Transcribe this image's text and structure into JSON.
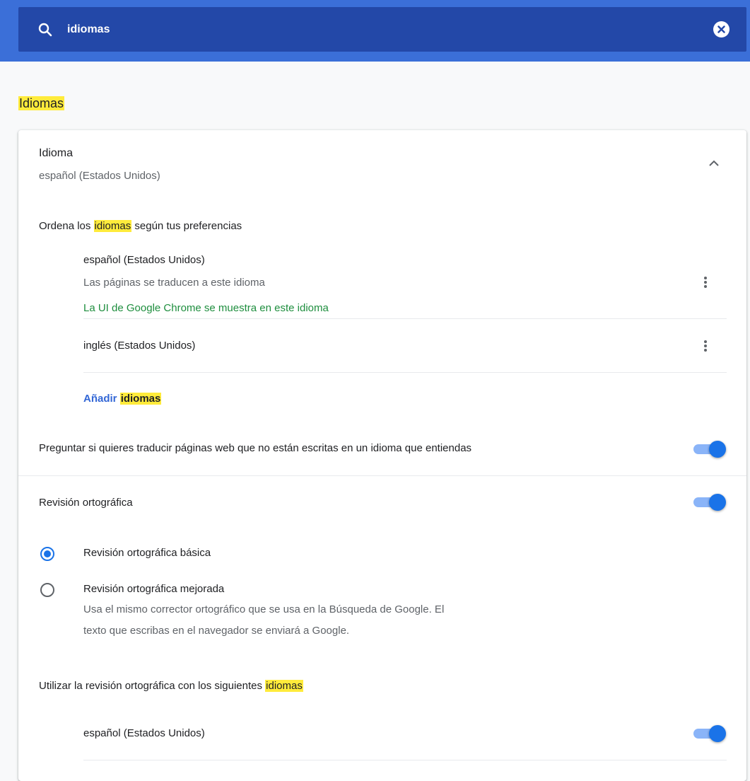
{
  "search": {
    "query": "idiomas"
  },
  "section": {
    "title": "Idiomas"
  },
  "language": {
    "header_label": "Idioma",
    "header_value": "español (Estados Unidos)",
    "order_prefix": "Ordena los ",
    "order_highlight": "idiomas",
    "order_suffix": " según tus preferencias",
    "items": [
      {
        "name": "español (Estados Unidos)",
        "note_translate": "Las páginas se traducen a este idioma",
        "note_ui": "La UI de Google Chrome se muestra en este idioma"
      },
      {
        "name": "inglés (Estados Unidos)"
      }
    ],
    "add_prefix": "Añadir ",
    "add_highlight": "idiomas",
    "offer_translate_label": "Preguntar si quieres traducir páginas web que no están escritas en un idioma que entiendas",
    "offer_translate_on": true
  },
  "spellcheck": {
    "label": "Revisión ortográfica",
    "enabled": true,
    "options": [
      {
        "label": "Revisión ortográfica básica",
        "selected": true
      },
      {
        "label": "Revisión ortográfica mejorada",
        "description_line1": "Usa el mismo corrector ortográfico que se usa en la Búsqueda de Google. El",
        "description_line2": "texto que escribas en el navegador se enviará a Google.",
        "selected": false
      }
    ],
    "languages_prefix": "Utilizar la revisión ortográfica con los siguientes ",
    "languages_highlight": "idiomas",
    "languages": [
      {
        "name": "español (Estados Unidos)",
        "enabled": true
      }
    ]
  },
  "colors": {
    "header_bg": "#3b6fd8",
    "search_bg": "#2348a8",
    "highlight": "#ffeb3b",
    "accent": "#1a73e8",
    "green_note": "#1e8e3e"
  },
  "icons": {
    "search": "search-icon",
    "clear": "close-circle-icon",
    "collapse": "chevron-up-icon",
    "more": "more-vert-icon"
  }
}
